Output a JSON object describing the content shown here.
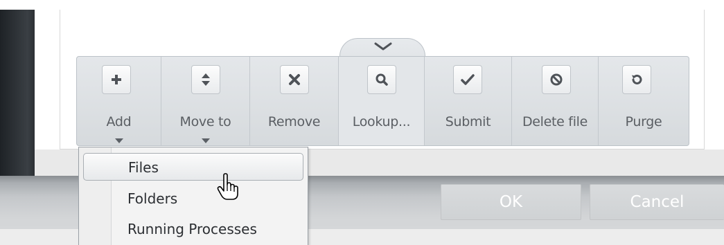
{
  "toolbar": {
    "items": [
      {
        "label": "Add",
        "icon": "plus-icon",
        "has_dropdown": true
      },
      {
        "label": "Move to",
        "icon": "up-down-arrows-icon",
        "has_dropdown": true
      },
      {
        "label": "Remove",
        "icon": "x-icon",
        "has_dropdown": false
      },
      {
        "label": "Lookup...",
        "icon": "magnifier-icon",
        "has_dropdown": false
      },
      {
        "label": "Submit",
        "icon": "checkmark-icon",
        "has_dropdown": false
      },
      {
        "label": "Delete file",
        "icon": "prohibited-icon",
        "has_dropdown": false
      },
      {
        "label": "Purge",
        "icon": "refresh-icon",
        "has_dropdown": false
      }
    ],
    "collapse_icon": "chevron-down-icon"
  },
  "add_menu": {
    "items": [
      {
        "label": "Files",
        "highlighted": true
      },
      {
        "label": "Folders",
        "highlighted": false
      },
      {
        "label": "Running Processes",
        "highlighted": false
      }
    ]
  },
  "dialog": {
    "ok_label": "OK",
    "cancel_label": "Cancel"
  },
  "cursor_icon": "hand-pointer-icon",
  "colors": {
    "toolbar_bg": "#dcdfe2",
    "icon_color": "#4f5358",
    "disabled_button_text": "#ffffff"
  }
}
